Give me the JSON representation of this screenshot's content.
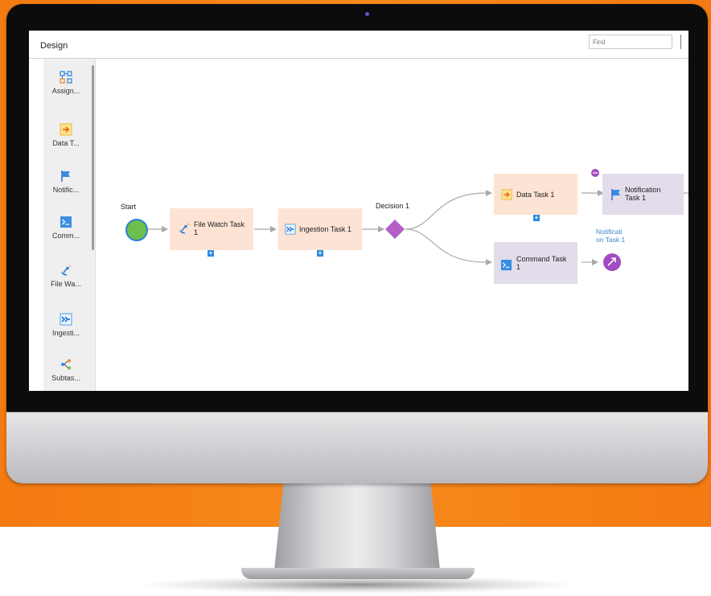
{
  "app": {
    "title": "Design",
    "search": {
      "placeholder": "Find",
      "value": ""
    }
  },
  "palette": {
    "items": [
      {
        "label": "Assign...",
        "icon": "assignment-icon"
      },
      {
        "label": "Data T...",
        "icon": "data-task-icon"
      },
      {
        "label": "Notific...",
        "icon": "flag-icon"
      },
      {
        "label": "Comm...",
        "icon": "terminal-icon"
      },
      {
        "label": "File Wa...",
        "icon": "satellite-icon"
      },
      {
        "label": "Ingesti...",
        "icon": "ingestion-icon"
      },
      {
        "label": "Subtas...",
        "icon": "subtask-icon"
      }
    ]
  },
  "flow": {
    "start_label": "Start",
    "file_watch_task": "File Watch Task\n1",
    "ingestion_task": "Ingestion Task 1",
    "decision_label": "Decision 1",
    "data_task": "Data Task 1",
    "notification_task": "Notification\nTask 1",
    "command_task": "Command Task\n1",
    "notification_link": "Notificati\non Task 1",
    "plus_glyph": "+"
  },
  "colors": {
    "accent_orange": "#f47a12",
    "task_fill": "#fde3d4",
    "command_fill": "#e3dcea",
    "start_green": "#6cbf4a",
    "decision_purple": "#b45fc6",
    "link_blue": "#3a86cc"
  }
}
